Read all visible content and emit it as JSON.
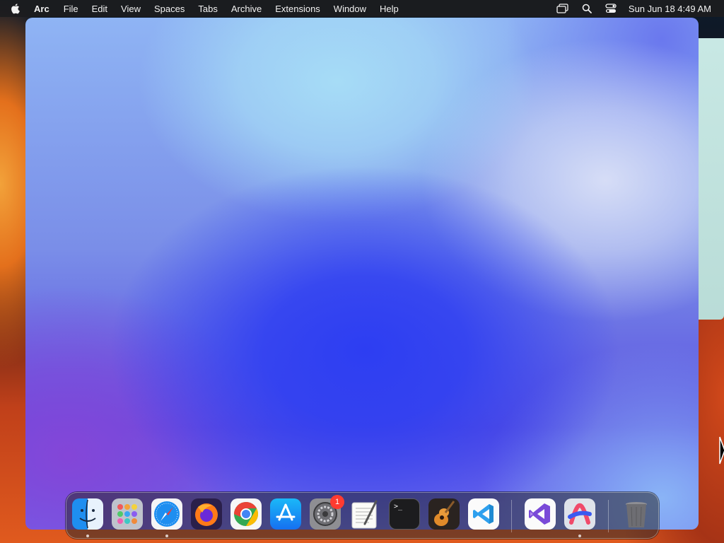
{
  "menubar": {
    "app_name": "Arc",
    "menus": [
      "File",
      "Edit",
      "View",
      "Spaces",
      "Tabs",
      "Archive",
      "Extensions",
      "Window",
      "Help"
    ],
    "status_icons": [
      "screen-mirroring-icon",
      "spotlight-search-icon",
      "control-center-icon"
    ],
    "clock": "Sun Jun 18  4:49 AM"
  },
  "dock": {
    "apps": [
      {
        "name": "Finder",
        "icon": "finder-icon",
        "running": true
      },
      {
        "name": "Launchpad",
        "icon": "launchpad-icon",
        "running": false
      },
      {
        "name": "Safari",
        "icon": "safari-icon",
        "running": true
      },
      {
        "name": "Firefox",
        "icon": "firefox-icon",
        "running": false
      },
      {
        "name": "Google Chrome",
        "icon": "chrome-icon",
        "running": false
      },
      {
        "name": "App Store",
        "icon": "app-store-icon",
        "running": false
      },
      {
        "name": "System Settings",
        "icon": "system-settings-icon",
        "running": false,
        "badge": "1"
      },
      {
        "name": "TextEdit",
        "icon": "textedit-icon",
        "running": false
      },
      {
        "name": "Terminal",
        "icon": "terminal-icon",
        "running": false
      },
      {
        "name": "GarageBand",
        "icon": "garageband-icon",
        "running": false
      },
      {
        "name": "Visual Studio Code",
        "icon": "vscode-icon",
        "running": false
      },
      {
        "name": "Visual Studio",
        "icon": "visual-studio-icon",
        "running": false
      },
      {
        "name": "Arc",
        "icon": "arc-icon",
        "running": true
      },
      {
        "name": "Trash",
        "icon": "trash-icon",
        "running": false
      }
    ],
    "terminal_glyph": ">_"
  }
}
